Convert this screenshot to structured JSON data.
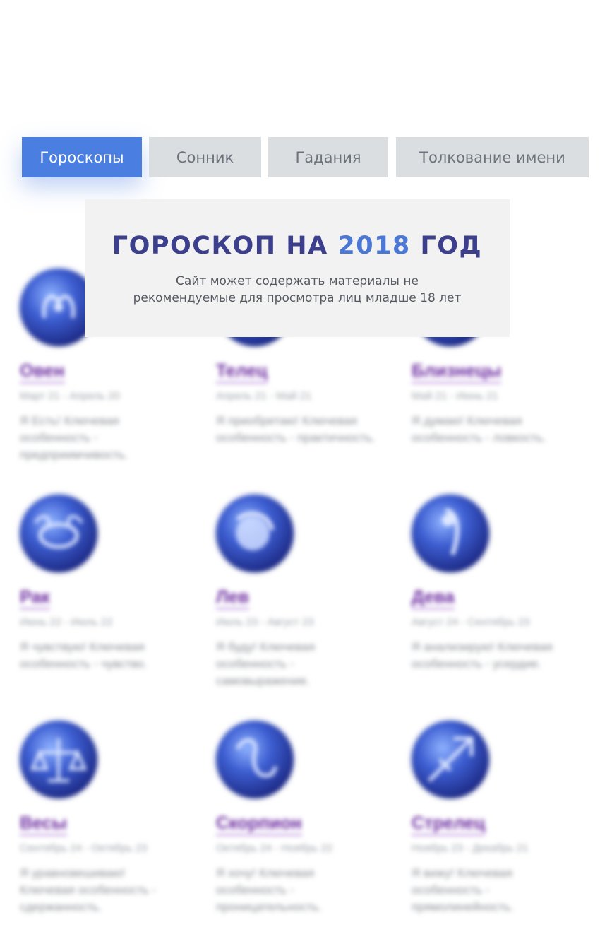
{
  "tabs": [
    {
      "label": "Гороскопы",
      "active": true
    },
    {
      "label": "Сонник",
      "active": false
    },
    {
      "label": "Гадания",
      "active": false
    },
    {
      "label": "Толкование имени",
      "active": false
    }
  ],
  "banner": {
    "title_prefix": "ГОРОСКОП НА",
    "title_year": "2018",
    "title_suffix": "ГОД",
    "subtitle_line1": "Сайт может содержать материалы не",
    "subtitle_line2": "рекомендуемые для просмотра лиц младше 18 лет"
  },
  "signs": [
    {
      "name": "Овен",
      "dates": "Март 21 - Апрель 20",
      "desc": "Я Есть! Ключевая особенность - предприимчивость.",
      "icon": "aries-icon"
    },
    {
      "name": "Телец",
      "dates": "Апрель 21 - Май 21",
      "desc": "Я приобретаю! Ключевая особенность - практичность.",
      "icon": "taurus-icon"
    },
    {
      "name": "Близнецы",
      "dates": "Май 21 - Июнь 21",
      "desc": "Я думаю! Ключевая особенность - ловкость.",
      "icon": "gemini-icon"
    },
    {
      "name": "Рак",
      "dates": "Июнь 22 - Июль 22",
      "desc": "Я чувствую! Ключевая особенность - чувство.",
      "icon": "cancer-icon"
    },
    {
      "name": "Лев",
      "dates": "Июль 23 - Август 23",
      "desc": "Я буду! Ключевая особенность - самовыражение.",
      "icon": "leo-icon"
    },
    {
      "name": "Дева",
      "dates": "Август 24 - Сентябрь 23",
      "desc": "Я анализирую! Ключевая особенность - усердие.",
      "icon": "virgo-icon"
    },
    {
      "name": "Весы",
      "dates": "Сентябрь 24 - Октябрь 23",
      "desc": "Я уравновешиваю! Ключевая особенность - сдержанность.",
      "icon": "libra-icon"
    },
    {
      "name": "Скорпион",
      "dates": "Октябрь 24 - Ноябрь 22",
      "desc": "Я хочу! Ключевая особенность - проницательность.",
      "icon": "scorpio-icon"
    },
    {
      "name": "Стрелец",
      "dates": "Ноябрь 23 - Декабрь 21",
      "desc": "Я вижу! Ключевая особенность - прямолинейность.",
      "icon": "sagittarius-icon"
    }
  ],
  "colors": {
    "tab_active": "#4a7ee0",
    "tab_inactive": "#dadee1",
    "sign_name": "#6b2aa0",
    "banner_title": "#3c3f8c",
    "banner_year": "#4a78d4"
  }
}
